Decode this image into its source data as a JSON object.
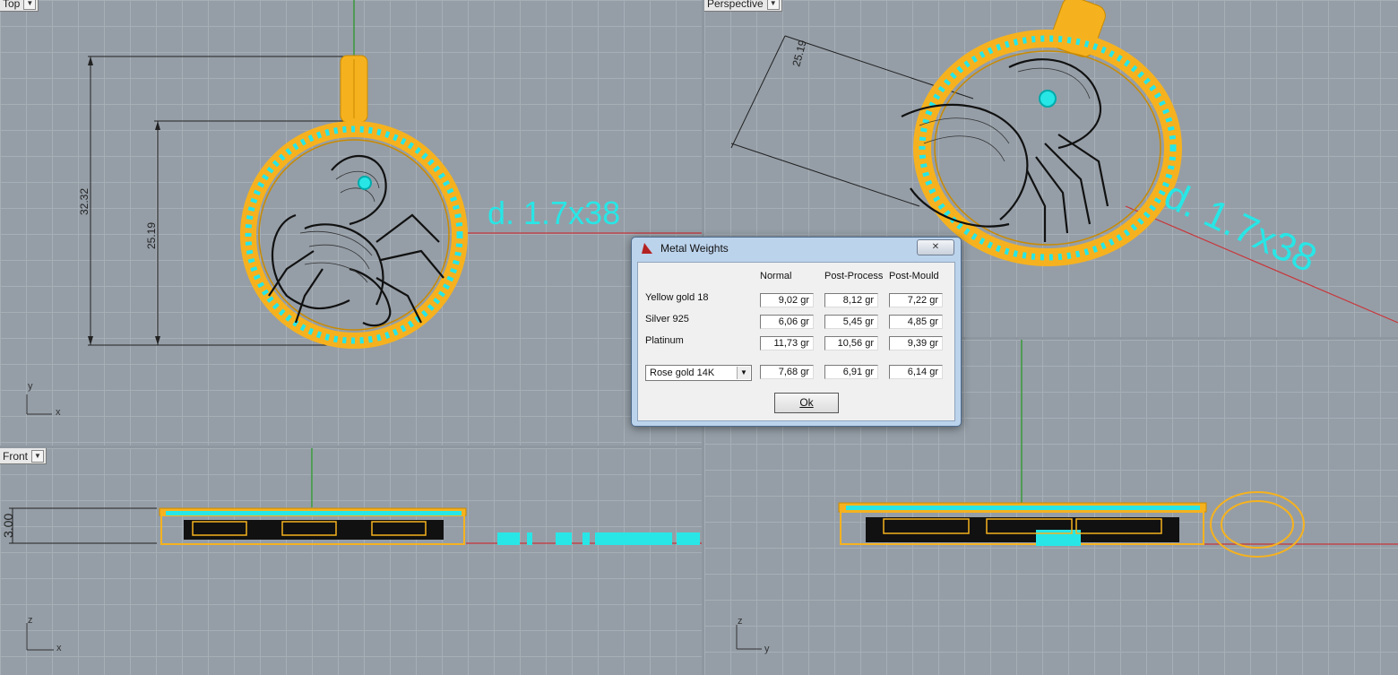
{
  "viewports": {
    "top": {
      "label": "Top",
      "dim_outer": "32.32",
      "dim_inner": "25.19",
      "stone_callout": "d. 1.7x38",
      "axis_y": "y",
      "axis_x": "x"
    },
    "perspective": {
      "label": "Perspective",
      "dim": "25.19",
      "stone_callout": "d. 1.7x38"
    },
    "front": {
      "label": "Front",
      "dim": "3.00",
      "axis_y": "z",
      "axis_x": "x"
    },
    "right": {
      "axis_y": "z",
      "axis_x": "y"
    }
  },
  "dialog": {
    "title": "Metal Weights",
    "close_label": "✕",
    "columns": [
      "Normal",
      "Post-Process",
      "Post-Mould"
    ],
    "rows": [
      {
        "label": "Yellow gold 18",
        "values": [
          "9,02 gr",
          "8,12 gr",
          "7,22 gr"
        ]
      },
      {
        "label": "Silver 925",
        "values": [
          "6,06 gr",
          "5,45 gr",
          "4,85 gr"
        ]
      },
      {
        "label": "Platinum",
        "values": [
          "11,73 gr",
          "10,56 gr",
          "9,39 gr"
        ]
      }
    ],
    "custom": {
      "selected": "Rose gold 14K",
      "values": [
        "7,68 gr",
        "6,91 gr",
        "6,14 gr"
      ]
    },
    "ok_label": "Ok"
  },
  "colors": {
    "viewport_bg": "#959ea7",
    "grid": "#a6aeb6",
    "gold": "#f6b21e",
    "stone": "#28e6e6",
    "axis_x": "#c8363a",
    "axis_y": "#3a9a3a"
  }
}
